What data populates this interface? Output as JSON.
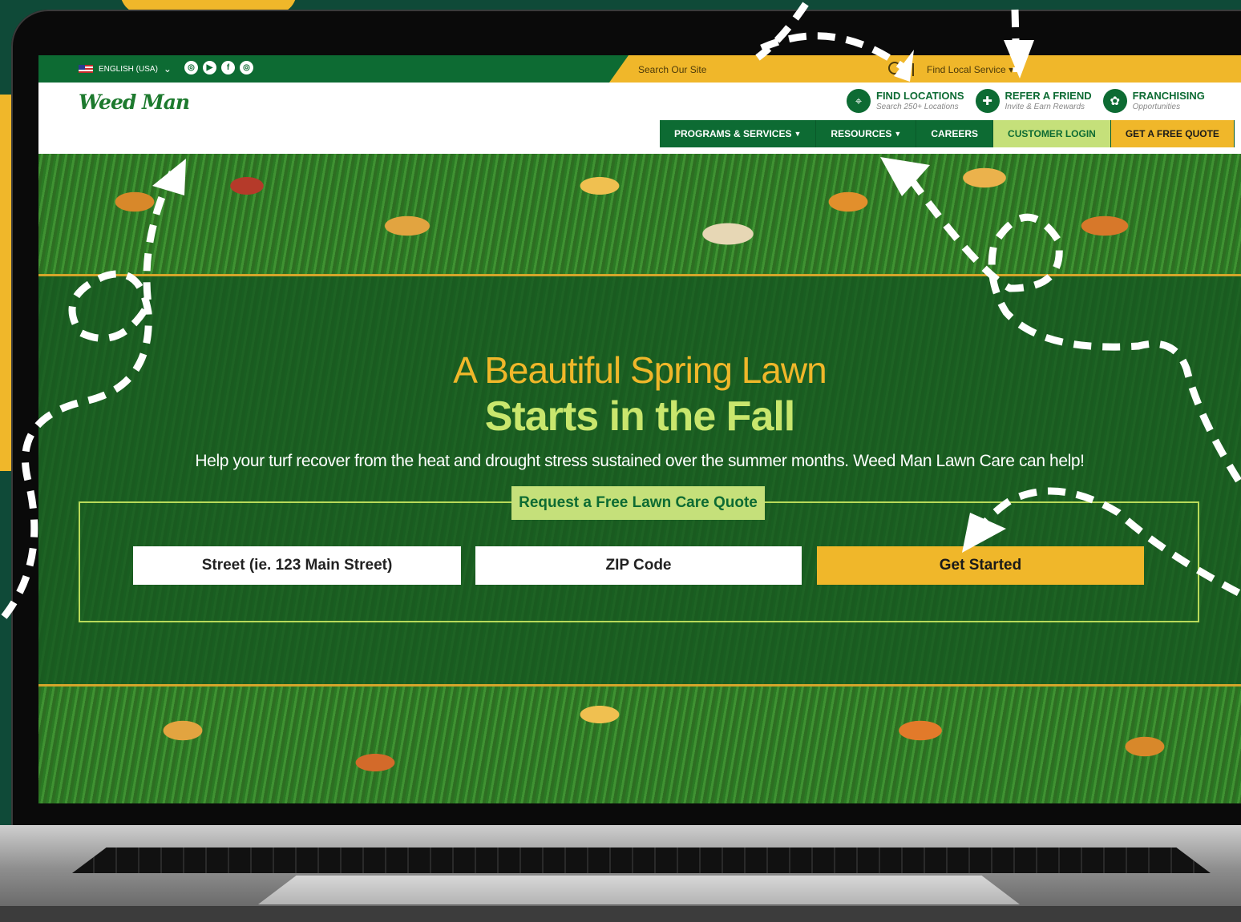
{
  "colors": {
    "brand_green": "#0d6b33",
    "accent_yellow": "#f0b72a",
    "light_green": "#c5e07a",
    "headline_green": "#c9e66d"
  },
  "topbar": {
    "language": "ENGLISH (USA)",
    "social_icons": [
      "instagram-icon",
      "youtube-icon",
      "facebook-icon",
      "instagram-icon"
    ],
    "search_placeholder": "Search Our Site",
    "find_local_service": "Find Local Service"
  },
  "header": {
    "logo_text": "Weed Man",
    "quick_links": [
      {
        "title": "FIND LOCATIONS",
        "subtitle": "Search 250+ Locations",
        "icon": "location-pin-icon"
      },
      {
        "title": "REFER A FRIEND",
        "subtitle": "Invite & Earn Rewards",
        "icon": "add-user-icon"
      },
      {
        "title": "FRANCHISING",
        "subtitle": "Opportunities",
        "icon": "handshake-icon"
      }
    ]
  },
  "nav": {
    "programs": "PROGRAMS & SERVICES",
    "resources": "RESOURCES",
    "careers": "CAREERS",
    "login": "CUSTOMER LOGIN",
    "quote": "GET A FREE QUOTE"
  },
  "hero": {
    "headline_line1": "A Beautiful Spring Lawn",
    "headline_line2": "Starts in the Fall",
    "subtext": "Help your turf recover from the heat and drought stress sustained over the summer months. Weed Man Lawn Care can help!",
    "form_title": "Request a Free Lawn Care Quote",
    "street_placeholder": "Street (ie. 123 Main Street)",
    "zip_placeholder": "ZIP Code",
    "cta": "Get Started"
  }
}
